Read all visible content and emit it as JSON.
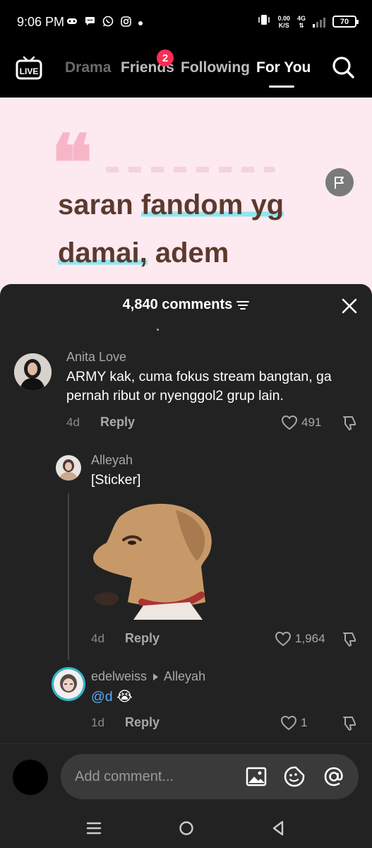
{
  "status_bar": {
    "time": "9:06 PM",
    "net_speed_value": "0.00",
    "net_speed_unit": "K/S",
    "network": "4G",
    "battery": "70"
  },
  "nav": {
    "live_label": "LIVE",
    "tabs": [
      {
        "label": "Drama"
      },
      {
        "label": "Friends"
      },
      {
        "label": "Following"
      },
      {
        "label": "For You"
      }
    ],
    "friends_badge": "2",
    "active_tab": "For You"
  },
  "video": {
    "quote_mark": "❝",
    "text_words": [
      "saran",
      "fandom",
      "yg",
      "damai,",
      "adem"
    ]
  },
  "comments_sheet": {
    "count_label": "4,840 comments",
    "comments": [
      {
        "username": "Anita Love",
        "text": "ARMY kak, cuma fokus stream bangtan, ga pernah ribut or nyenggol2 grup lain.",
        "time": "4d",
        "reply_label": "Reply",
        "likes": "491"
      },
      {
        "username": "Alleyah",
        "text": "[Sticker]",
        "time": "4d",
        "reply_label": "Reply",
        "likes": "1,964"
      },
      {
        "username": "edelweiss",
        "reply_to": "Alleyah",
        "mention": "@d",
        "emoji": "😭",
        "time": "1d",
        "reply_label": "Reply",
        "likes": "1"
      }
    ]
  },
  "input": {
    "placeholder": "Add comment..."
  },
  "colors": {
    "accent": "#fe2c55",
    "sheet_bg": "#222222",
    "video_bg": "#fde9f0",
    "mention": "#5aa9ff"
  }
}
